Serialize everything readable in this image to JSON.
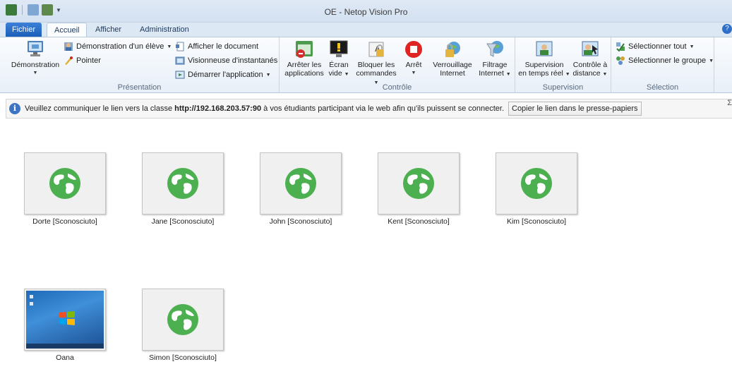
{
  "window": {
    "title": "OE - Netop Vision Pro"
  },
  "tabs": {
    "file": "Fichier",
    "home": "Accueil",
    "view": "Afficher",
    "admin": "Administration"
  },
  "ribbon": {
    "presentation": {
      "label": "Présentation",
      "demo": "Démonstration",
      "student_demo": "Démonstration d'un élève",
      "pointer": "Pointer",
      "show_document": "Afficher le document",
      "snapshot_viewer": "Visionneuse d'instantanés",
      "start_app": "Démarrer l'application"
    },
    "control": {
      "label": "Contrôle",
      "stop_apps_1": "Arrêter les",
      "stop_apps_2": "applications",
      "blank_screen_1": "Écran",
      "blank_screen_2": "vide",
      "lock_cmds_1": "Bloquer les",
      "lock_cmds_2": "commandes",
      "stop_1": "Arrêt",
      "lock_internet_1": "Verrouillage",
      "lock_internet_2": "Internet",
      "filter_internet_1": "Filtrage",
      "filter_internet_2": "Internet"
    },
    "supervision": {
      "label": "Supervision",
      "realtime_1": "Supervision",
      "realtime_2": "en temps réel",
      "remote_1": "Contrôle à",
      "remote_2": "distance"
    },
    "selection": {
      "label": "Sélection",
      "select_all": "Sélectionner tout",
      "select_group": "Sélectionner le groupe"
    }
  },
  "infobar": {
    "text_before": "Veuillez communiquer le lien vers la classe",
    "link": "http://192.168.203.57:90",
    "text_after": "à vos étudiants participant via le web afin qu'ils puissent se connecter.",
    "copy_button": "Copier le lien dans le presse-papiers",
    "sigma": "Σ"
  },
  "students": [
    {
      "name": "Dorte [Sconosciuto]",
      "type": "web"
    },
    {
      "name": "Jane [Sconosciuto]",
      "type": "web"
    },
    {
      "name": "John [Sconosciuto]",
      "type": "web"
    },
    {
      "name": "Kent [Sconosciuto]",
      "type": "web"
    },
    {
      "name": "Kim [Sconosciuto]",
      "type": "web"
    },
    {
      "name": "Oana",
      "type": "desktop"
    },
    {
      "name": "Simon [Sconosciuto]",
      "type": "web"
    }
  ],
  "colors": {
    "globe": "#4caf50",
    "accent": "#2f6fc9"
  }
}
